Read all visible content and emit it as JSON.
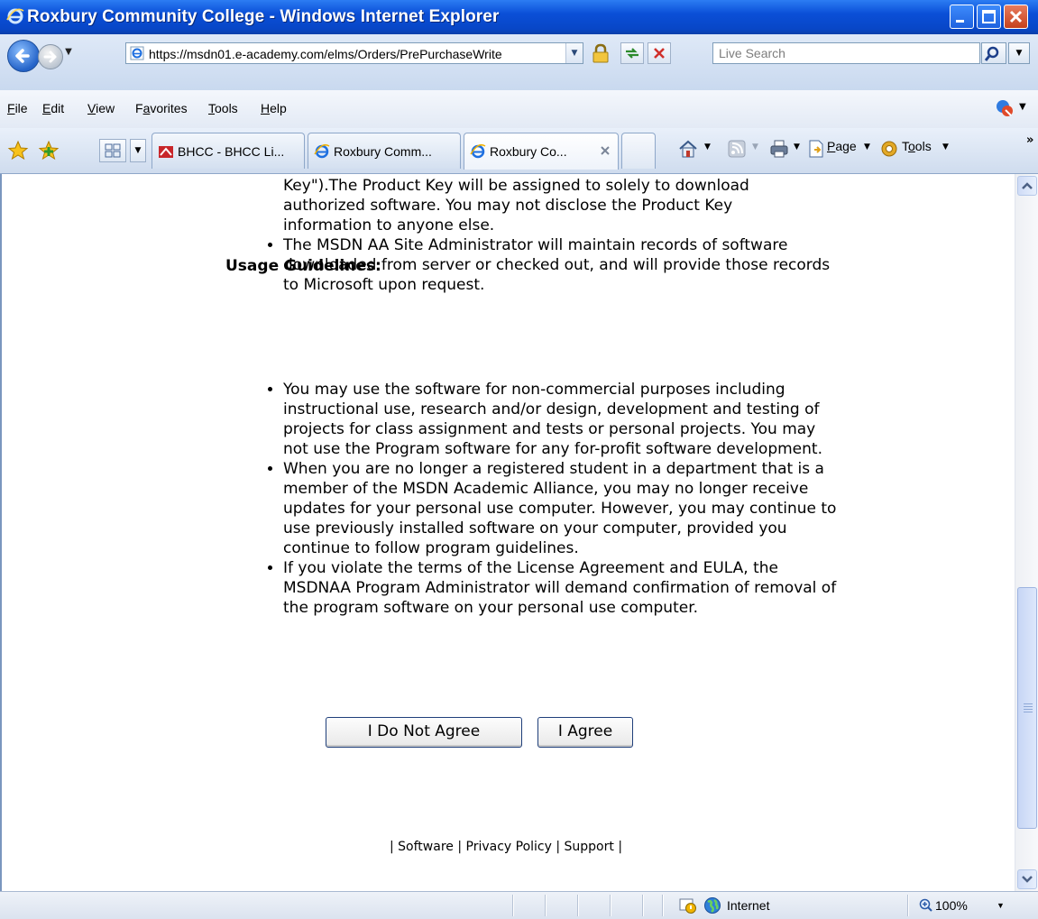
{
  "window": {
    "title": "Roxbury Community College - Windows Internet Explorer"
  },
  "address_bar": {
    "url": "https://msdn01.e-academy.com/elms/Orders/PrePurchaseWrite",
    "search_placeholder": "Live Search"
  },
  "menu": {
    "items": [
      {
        "underline": "F",
        "rest": "ile"
      },
      {
        "underline": "E",
        "rest": "dit"
      },
      {
        "underline": "V",
        "rest": "iew"
      },
      {
        "pre": "F",
        "underline": "a",
        "rest": "vorites"
      },
      {
        "underline": "T",
        "rest": "ools"
      },
      {
        "underline": "H",
        "rest": "elp"
      }
    ]
  },
  "tabs": [
    {
      "label": "BHCC - BHCC Li...",
      "active": false
    },
    {
      "label": "Roxbury Comm...",
      "active": false
    },
    {
      "label": "Roxbury Co...",
      "active": true
    }
  ],
  "toolbar": {
    "page_label": "Page",
    "page_underline": "P",
    "tools_label": "Tools",
    "tools_underline": "o"
  },
  "content": {
    "prev_lines": [
      "Key\").The Product Key will be assigned to solely to download",
      "authorized software. You may not disclose the Product Key",
      "information to anyone else."
    ],
    "prev_bullet": "The MSDN AA Site Administrator will maintain records of software downloaded from server or checked out, and will provide those records to Microsoft upon request.",
    "usage_heading": "Usage Guidelines:",
    "guidelines": [
      "You may use the software for non-commercial purposes including instructional use, research and/or design, development and testing of projects for class assignment and tests or personal projects. You may not use the Program software for any for-profit software development.",
      "When you are no longer a registered student in a department that is a member of the MSDN Academic Alliance, you may no longer receive updates for your personal use computer. However, you may continue to use previously installed software on your computer, provided you continue to follow program guidelines.",
      "If you violate the terms of the License Agreement and EULA, the MSDNAA Program Administrator will demand confirmation of removal of the program software on your personal use computer."
    ],
    "disagree_button": "I Do Not Agree",
    "agree_button": "I Agree",
    "footer": "| Software | Privacy Policy | Support |"
  },
  "status_bar": {
    "zone": "Internet",
    "zoom": "100%"
  },
  "colors": {
    "titlebar": "#0a4fd7",
    "chrome": "#dbe5f2"
  }
}
